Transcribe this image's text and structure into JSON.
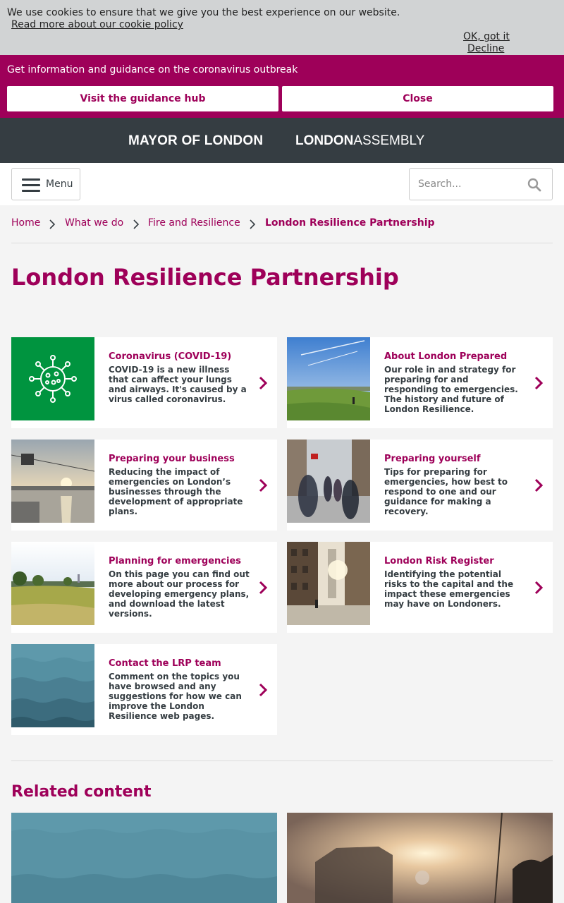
{
  "cookie_banner": {
    "message": "We use cookies to ensure that we give you the best experience on our website.",
    "policy_link": "Read more about our cookie policy",
    "accept_label": "OK, got it",
    "decline_label": "Decline"
  },
  "covid_banner": {
    "message": "Get information and guidance on the coronavirus outbreak",
    "hub_button": "Visit the guidance hub",
    "close_button": "Close"
  },
  "logos": {
    "mayor": "MAYOR OF LONDON",
    "assembly_bold": "LONDON",
    "assembly_light": "ASSEMBLY"
  },
  "nav": {
    "menu_label": "Menu",
    "search_placeholder": "Search..."
  },
  "breadcrumb": [
    "Home",
    "What we do",
    "Fire and Resilience",
    "London Resilience Partnership"
  ],
  "page_title": "London Resilience Partnership",
  "cards": [
    {
      "title": "Coronavirus (COVID-19)",
      "desc": "COVID-19 is a new illness that can affect your lungs and airways. It's caused by a virus called coronavirus.",
      "image": "virus-icon"
    },
    {
      "title": "About London Prepared",
      "desc": "Our role in and strategy for preparing for and responding to emergencies. The history and future of London Resilience.",
      "image": "park-skyline-photo"
    },
    {
      "title": "Preparing your business",
      "desc": "Reducing the impact of emergencies on London’s businesses through the development of appropriate plans.",
      "image": "cable-car-river-photo"
    },
    {
      "title": "Preparing yourself",
      "desc": "Tips for preparing for emergencies, how best to respond to one and our guidance for making a recovery.",
      "image": "busy-street-photo"
    },
    {
      "title": "Planning for emergencies",
      "desc": "On this page you can find out more about our process for developing emergency plans, and download the latest versions.",
      "image": "hill-park-photo"
    },
    {
      "title": "London Risk Register",
      "desc": "Identifying the potential risks to the capital and the impact these emergencies may have on Londoners.",
      "image": "city-street-sun-photo"
    },
    {
      "title": "Contact the LRP team",
      "desc": "Comment on the topics you have browsed and any suggestions for how we can improve the London Resilience web pages.",
      "image": "waves-pattern"
    }
  ],
  "related": {
    "title": "Related content",
    "items": [
      {
        "image": "waves-pattern"
      },
      {
        "image": "stadium-sunset-photo"
      }
    ]
  },
  "colors": {
    "brand": "#9e0059",
    "dark": "#353d42",
    "cookie_bg": "#d1d3d4",
    "covid_green": "#00943f"
  }
}
